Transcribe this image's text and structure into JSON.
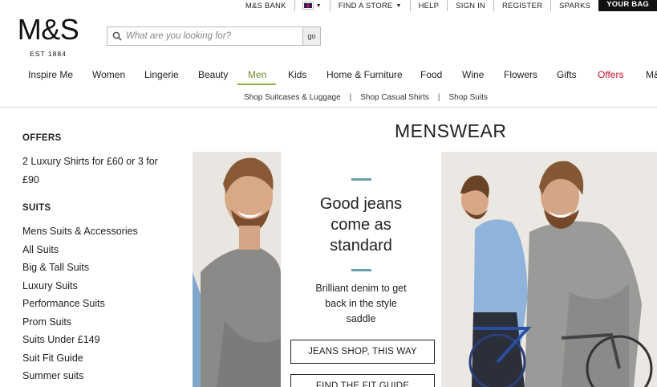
{
  "utility": {
    "bank": "M&S BANK",
    "store": "FIND A STORE",
    "help": "HELP",
    "signin": "SIGN IN",
    "register": "REGISTER",
    "sparks": "SPARKS",
    "bag": "YOUR BAG"
  },
  "logo": {
    "mark": "M&S",
    "est": "EST 1884"
  },
  "search": {
    "placeholder": "What are you looking for?",
    "go": "go"
  },
  "nav": {
    "items": [
      "Inspire Me",
      "Women",
      "Lingerie",
      "Beauty",
      "Men",
      "Kids",
      "Home & Furniture",
      "Food",
      "Wine",
      "Flowers",
      "Gifts",
      "Offers",
      "M&S"
    ],
    "active": "Men",
    "accent": "#8ab33c",
    "offers_color": "#c8102e"
  },
  "subnav": [
    "Shop Suitcases & Luggage",
    "Shop Casual Shirts",
    "Shop Suits"
  ],
  "page_title": "MENSWEAR",
  "left": {
    "offers_title": "OFFERS",
    "offer_text": "2 Luxury Shirts for £60 or 3 for £90",
    "suits_title": "SUITS",
    "suits": [
      "Mens Suits & Accessories",
      "All Suits",
      "Big & Tall Suits",
      "Luxury Suits",
      "Performance Suits",
      "Prom Suits",
      "Suits Under £149",
      "Suit Fit Guide",
      "Summer suits"
    ]
  },
  "promo": {
    "headline": "Good jeans come as standard",
    "body": "Brilliant denim to get back in the style saddle",
    "button1": "JEANS SHOP, THIS WAY",
    "button2": "FIND THE FIT GUIDE",
    "dash_color": "#6aa0a8"
  }
}
